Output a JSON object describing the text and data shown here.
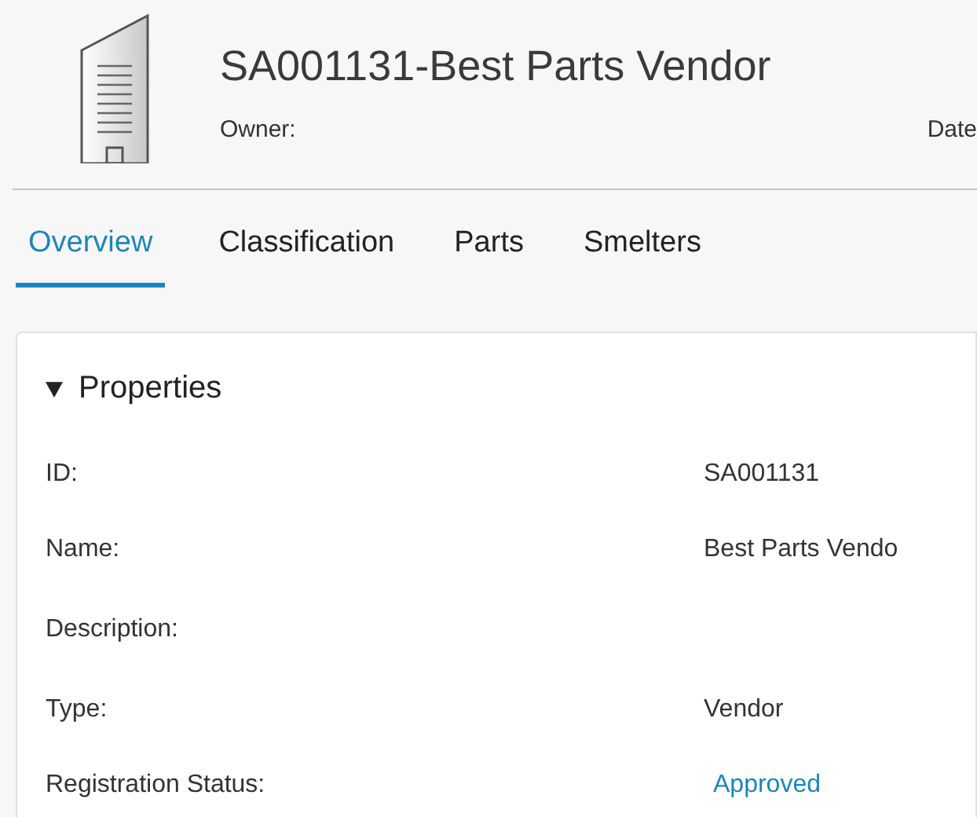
{
  "header": {
    "title": "SA001131-Best Parts Vendor",
    "owner_label": "Owner:",
    "date_label": "Date"
  },
  "tabs": [
    {
      "label": "Overview",
      "selected": true
    },
    {
      "label": "Classification",
      "selected": false
    },
    {
      "label": "Parts",
      "selected": false
    },
    {
      "label": "Smelters",
      "selected": false
    }
  ],
  "section": {
    "title": "Properties",
    "expanded": true,
    "rows": [
      {
        "label": "ID:",
        "value": "SA001131",
        "kind": "text"
      },
      {
        "label": "Name:",
        "value": "Best Parts Vendo",
        "kind": "text"
      },
      {
        "label": "Description:"
      },
      {
        "label": "Type:",
        "value": "Vendor",
        "kind": "text"
      },
      {
        "label": "Registration Status:",
        "value": "Approved",
        "kind": "link"
      }
    ]
  }
}
